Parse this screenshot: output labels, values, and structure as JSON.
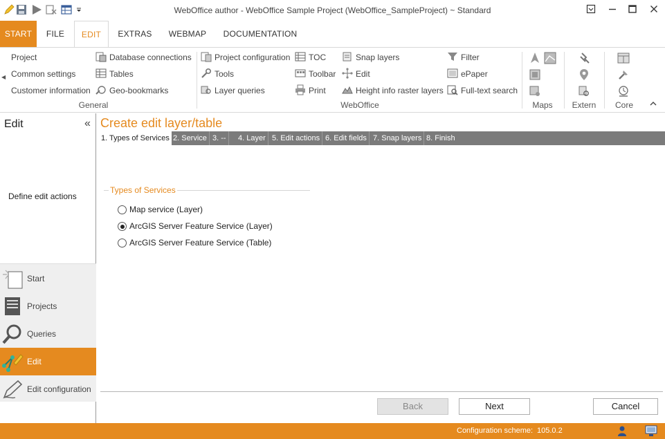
{
  "window": {
    "title": "WebOffice author - WebOffice Sample Project (WebOffice_SampleProject) ~ Standard"
  },
  "tabs": [
    {
      "label": "START"
    },
    {
      "label": "FILE"
    },
    {
      "label": "EDIT"
    },
    {
      "label": "EXTRAS"
    },
    {
      "label": "WEBMAP"
    },
    {
      "label": "DOCUMENTATION"
    }
  ],
  "ribbon": {
    "general": {
      "label": "General",
      "items": [
        "Project",
        "Common settings",
        "Customer information",
        "Database connections",
        "Tables",
        "Geo-bookmarks"
      ]
    },
    "weboffice": {
      "label": "WebOffice",
      "items": [
        "Project configuration",
        "Tools",
        "Layer queries",
        "TOC",
        "Toolbar",
        "Print",
        "Snap layers",
        "Edit",
        "Height info raster layers",
        "Filter",
        "ePaper",
        "Full-text search"
      ]
    },
    "maps": {
      "label": "Maps"
    },
    "extern": {
      "label": "Extern"
    },
    "core": {
      "label": "Core"
    }
  },
  "left_panel": {
    "title": "Edit",
    "collapse_glyph": "«",
    "description": "Define edit actions",
    "nav": [
      {
        "label": "Start",
        "icon": "start-icon"
      },
      {
        "label": "Projects",
        "icon": "projects-icon"
      },
      {
        "label": "Queries",
        "icon": "queries-icon"
      },
      {
        "label": "Edit",
        "icon": "edit-icon",
        "active": true
      },
      {
        "label": "Edit configuration",
        "icon": "edit-configuration-icon"
      }
    ]
  },
  "main": {
    "heading": "Create edit layer/table",
    "steps": [
      {
        "label": "1. Types of Services",
        "active": true
      },
      {
        "label": "2. Service"
      },
      {
        "label": "3. --"
      },
      {
        "label": "4. Layer"
      },
      {
        "label": "5. Edit actions"
      },
      {
        "label": "6. Edit fields"
      },
      {
        "label": "7. Snap layers"
      },
      {
        "label": "8. Finish"
      }
    ],
    "types_group": {
      "legend": "Types of Services",
      "options": [
        {
          "label": "Map service (Layer)",
          "checked": false
        },
        {
          "label": "ArcGIS Server Feature Service (Layer)",
          "checked": true
        },
        {
          "label": "ArcGIS Server Feature Service (Table)",
          "checked": false
        }
      ]
    },
    "buttons": {
      "back": "Back",
      "next": "Next",
      "cancel": "Cancel"
    }
  },
  "status": {
    "label": "Configuration scheme:",
    "value": "105.0.2"
  },
  "colors": {
    "accent": "#e58a1f",
    "step_bar": "#7b7b7b"
  }
}
